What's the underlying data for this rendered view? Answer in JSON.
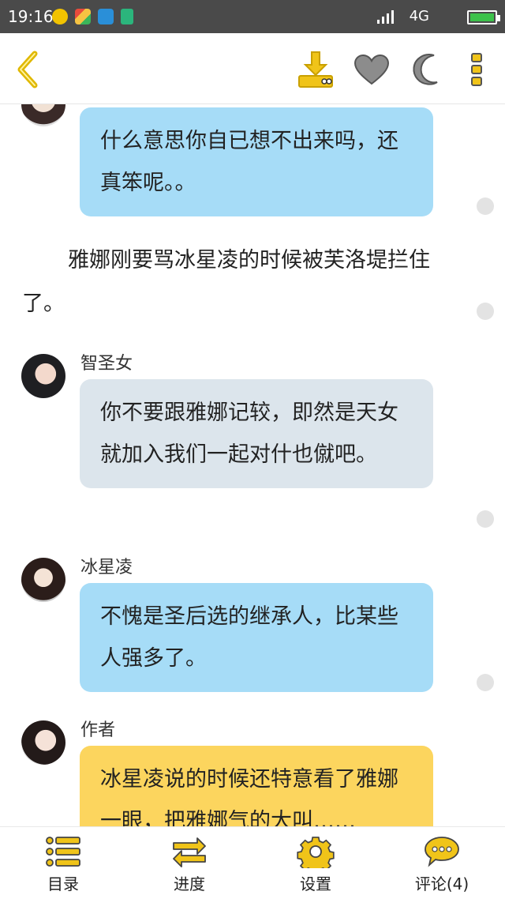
{
  "status_bar": {
    "time": "19:16",
    "network": "4G",
    "colors": {
      "battery": "#3cc24a"
    }
  },
  "toolbar": {
    "icons": [
      "back-icon",
      "download-icon",
      "heart-icon",
      "moon-icon",
      "more-icon"
    ],
    "accent_color": "#e0b800"
  },
  "messages": [
    {
      "type": "bubble",
      "speaker": "",
      "style": "blue",
      "text": "什么意思你自已想不出来吗，还真笨呢。。"
    },
    {
      "type": "narration",
      "text": "雅娜刚要骂冰星凌的时候被芙洛堤拦住了。"
    },
    {
      "type": "bubble",
      "speaker": "智圣女",
      "style": "gray",
      "text": "你不要跟雅娜记较，即然是天女就加入我们一起对什也僦吧。"
    },
    {
      "type": "bubble",
      "speaker": "冰星凌",
      "style": "blue",
      "text": "不愧是圣后选的继承人，比某些人强多了。"
    },
    {
      "type": "bubble",
      "speaker": "作者",
      "style": "yellow",
      "text": "冰星凌说的时候还特意看了雅娜一眼，把雅娜气的大叫……"
    }
  ],
  "bottom_nav": [
    {
      "label": "目录",
      "icon": "list-icon"
    },
    {
      "label": "进度",
      "icon": "progress-arrows-icon"
    },
    {
      "label": "设置",
      "icon": "settings-gear-icon"
    },
    {
      "label": "评论(4)",
      "icon": "comment-icon"
    }
  ],
  "colors": {
    "bubble_blue": "#a6dcf7",
    "bubble_gray": "#dce5ec",
    "bubble_yellow": "#fcd55e",
    "icon_gray": "#8c8c8c"
  }
}
